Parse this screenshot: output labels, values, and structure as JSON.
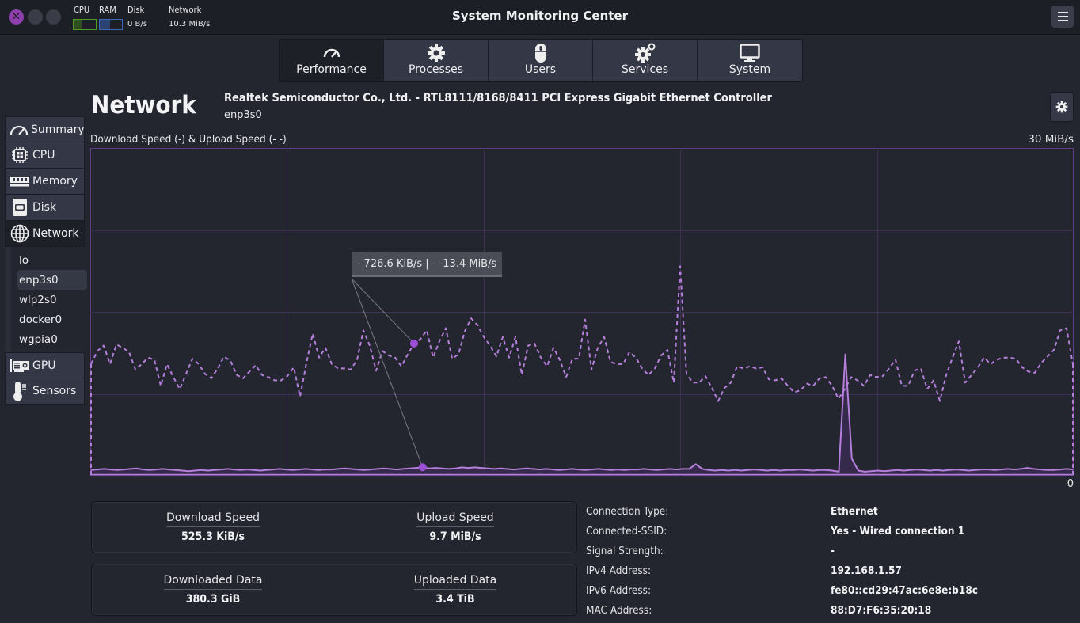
{
  "window": {
    "title": "System Monitoring Center",
    "controls": [
      "close",
      "minimize",
      "maximize"
    ]
  },
  "headerbar": {
    "cpu_label": "CPU",
    "ram_label": "RAM",
    "disk_label": "Disk",
    "disk_value": "0 B/s",
    "network_label": "Network",
    "network_value": "10.3 MiB/s",
    "cpu_usage_fraction": 0.35,
    "ram_usage_fraction": 0.45,
    "colors": {
      "cpu": "#4e9a22",
      "ram": "#3c68b8",
      "close": "#8e3fae"
    }
  },
  "tabs": [
    {
      "label": "Performance",
      "icon": "speedometer-icon",
      "active": true
    },
    {
      "label": "Processes",
      "icon": "gear-icon",
      "active": false
    },
    {
      "label": "Users",
      "icon": "mouse-icon",
      "active": false
    },
    {
      "label": "Services",
      "icon": "gears-icon",
      "active": false
    },
    {
      "label": "System",
      "icon": "monitor-icon",
      "active": false
    }
  ],
  "sidebar": {
    "items": [
      {
        "label": "Summary",
        "icon": "speedometer-icon"
      },
      {
        "label": "CPU",
        "icon": "cpu-chip-icon"
      },
      {
        "label": "Memory",
        "icon": "memory-module-icon"
      },
      {
        "label": "Disk",
        "icon": "disk-drive-icon"
      },
      {
        "label": "Network",
        "icon": "globe-icon",
        "active": true
      },
      {
        "label": "GPU",
        "icon": "gpu-card-icon"
      },
      {
        "label": "Sensors",
        "icon": "thermometer-icon"
      }
    ],
    "network_interfaces": [
      "lo",
      "enp3s0",
      "wlp2s0",
      "docker0",
      "wgpia0"
    ],
    "selected_interface": "enp3s0"
  },
  "main": {
    "title": "Network",
    "device_name": "Realtek Semiconductor Co., Ltd. - RTL8111/8168/8411 PCI Express Gigabit Ethernet Controller",
    "interface": "enp3s0",
    "tooltip": "-  726.6 KiB/s  |  - -13.4 MiB/s",
    "stats": [
      {
        "label": "Download Speed",
        "value": "525.3 KiB/s"
      },
      {
        "label": "Upload Speed",
        "value": "9.7 MiB/s"
      },
      {
        "label": "Downloaded Data",
        "value": "380.3 GiB"
      },
      {
        "label": "Uploaded Data",
        "value": "3.4 TiB"
      }
    ],
    "info": [
      {
        "key": "Connection Type:",
        "value": "Ethernet"
      },
      {
        "key": "Connected-SSID:",
        "value": "Yes - Wired connection 1"
      },
      {
        "key": "Signal Strength:",
        "value": "-"
      },
      {
        "key": "IPv4 Address:",
        "value": "192.168.1.57"
      },
      {
        "key": "IPv6 Address:",
        "value": "fe80::cd29:47ac:6e8e:b18c"
      },
      {
        "key": "MAC Address:",
        "value": "88:D7:F6:35:20:18"
      }
    ]
  },
  "chart_data": {
    "type": "line",
    "title": "Download Speed (-) & Upload Speed (- -)",
    "ymax_label": "30 MiB/s",
    "ymin_label": "0",
    "ylim": [
      0,
      30
    ],
    "yunit": "MiB/s",
    "grid": true,
    "grid_divisions": {
      "x": 5,
      "y": 4
    },
    "line_color": "#b67fdc",
    "hover_index": 51,
    "series": [
      {
        "name": "Download Speed",
        "style": "solid",
        "filled": true,
        "values": [
          0.45,
          0.5,
          0.55,
          0.5,
          0.45,
          0.5,
          0.55,
          0.6,
          0.5,
          0.45,
          0.5,
          0.55,
          0.5,
          0.45,
          0.4,
          0.35,
          0.4,
          0.45,
          0.4,
          0.45,
          0.5,
          0.55,
          0.5,
          0.45,
          0.5,
          0.45,
          0.4,
          0.45,
          0.5,
          0.55,
          0.5,
          0.45,
          0.5,
          0.55,
          0.5,
          0.45,
          0.5,
          0.5,
          0.55,
          0.6,
          0.55,
          0.5,
          0.45,
          0.5,
          0.55,
          0.6,
          0.55,
          0.5,
          0.55,
          0.6,
          0.65,
          0.71,
          0.6,
          0.65,
          0.6,
          0.55,
          0.6,
          0.7,
          0.65,
          0.7,
          0.65,
          0.6,
          0.55,
          0.6,
          0.55,
          0.5,
          0.55,
          0.6,
          0.55,
          0.5,
          0.55,
          0.5,
          0.45,
          0.5,
          0.55,
          0.5,
          0.45,
          0.5,
          0.55,
          0.5,
          0.45,
          0.5,
          0.45,
          0.5,
          0.5,
          0.55,
          0.5,
          0.45,
          0.5,
          0.55,
          0.5,
          0.55,
          0.55,
          1.0,
          0.55,
          0.45,
          0.4,
          0.45,
          0.4,
          0.45,
          0.4,
          0.45,
          0.5,
          0.45,
          0.4,
          0.45,
          0.4,
          0.45,
          0.45,
          0.5,
          0.45,
          0.4,
          0.45,
          0.45,
          0.4,
          0.3,
          11.1,
          1.5,
          0.4,
          0.3,
          0.35,
          0.4,
          0.35,
          0.4,
          0.45,
          0.4,
          0.45,
          0.5,
          0.45,
          0.4,
          0.45,
          0.4,
          0.45,
          0.5,
          0.45,
          0.4,
          0.45,
          0.5,
          0.5,
          0.45,
          0.5,
          0.55,
          0.5,
          0.55,
          0.65,
          0.55,
          0.5,
          0.45,
          0.45,
          0.5,
          0.55,
          0.5
        ]
      },
      {
        "name": "Upload Speed",
        "style": "dashed",
        "filled": false,
        "values": [
          10.2,
          11.4,
          11.9,
          10.2,
          12.0,
          11.7,
          11.3,
          9.7,
          10.2,
          10.8,
          10.6,
          8.2,
          10.2,
          9.0,
          7.9,
          9.3,
          10.7,
          10.2,
          9.3,
          8.9,
          9.8,
          10.9,
          10.5,
          9.2,
          8.9,
          9.5,
          10.1,
          9.2,
          9.0,
          8.7,
          8.7,
          9.1,
          9.9,
          7.2,
          10.3,
          13.0,
          10.8,
          11.7,
          10.2,
          9.8,
          9.8,
          9.7,
          10.6,
          13.3,
          11.9,
          9.6,
          11.4,
          11.0,
          10.8,
          10.0,
          11.1,
          12.1,
          12.5,
          13.3,
          10.8,
          12.3,
          13.5,
          10.7,
          11.1,
          13.2,
          14.4,
          13.8,
          12.7,
          11.9,
          10.9,
          12.7,
          10.8,
          12.7,
          9.2,
          11.9,
          12.1,
          10.8,
          10.0,
          11.7,
          10.6,
          9.0,
          10.7,
          10.7,
          14.3,
          9.7,
          11.7,
          12.7,
          10.4,
          10.2,
          10.2,
          11.3,
          10.8,
          9.8,
          9.2,
          9.8,
          11.0,
          11.5,
          8.5,
          19.2,
          9.3,
          8.5,
          8.5,
          9.1,
          8.0,
          6.8,
          8.0,
          8.5,
          10.0,
          9.8,
          10.0,
          9.8,
          9.9,
          8.8,
          8.7,
          8.9,
          8.2,
          7.6,
          7.8,
          8.4,
          8.2,
          8.9,
          9.0,
          8.2,
          7.0,
          7.9,
          9.0,
          8.7,
          8.2,
          9.2,
          9.0,
          9.1,
          9.8,
          10.6,
          8.2,
          8.2,
          9.6,
          9.8,
          7.9,
          8.7,
          6.8,
          9.2,
          10.8,
          12.3,
          8.5,
          9.2,
          9.9,
          10.8,
          10.2,
          10.6,
          10.8,
          10.8,
          10.7,
          9.9,
          9.5,
          9.4,
          10.3,
          10.9,
          11.5,
          13.3,
          13.5,
          10.2
        ]
      }
    ]
  }
}
